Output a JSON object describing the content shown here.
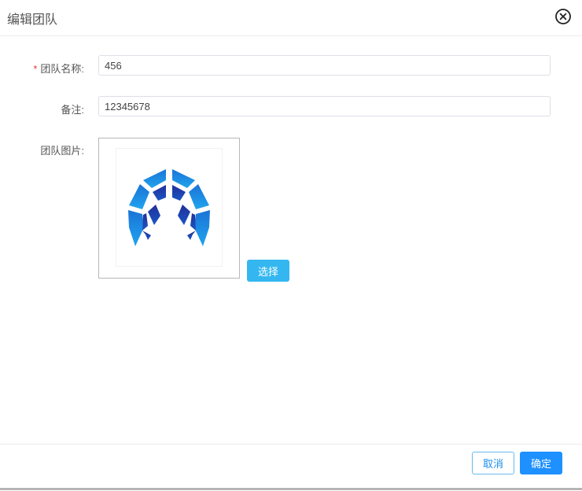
{
  "dialog": {
    "title": "编辑团队",
    "close_icon": "close-circle-icon"
  },
  "form": {
    "team_name": {
      "required_mark": "*",
      "label": "团队名称:",
      "value": "456"
    },
    "remark": {
      "label": "备注:",
      "value": "12345678"
    },
    "team_image": {
      "label": "团队图片:",
      "image_icon": "team-logo-icon",
      "select_label": "选择"
    }
  },
  "footer": {
    "cancel_label": "取消",
    "confirm_label": "确定"
  },
  "colors": {
    "primary": "#1e90ff",
    "select_button": "#34b7f0",
    "required": "#e4393c",
    "logo_light": "#1e88e5",
    "logo_dark": "#1a2f8f"
  }
}
